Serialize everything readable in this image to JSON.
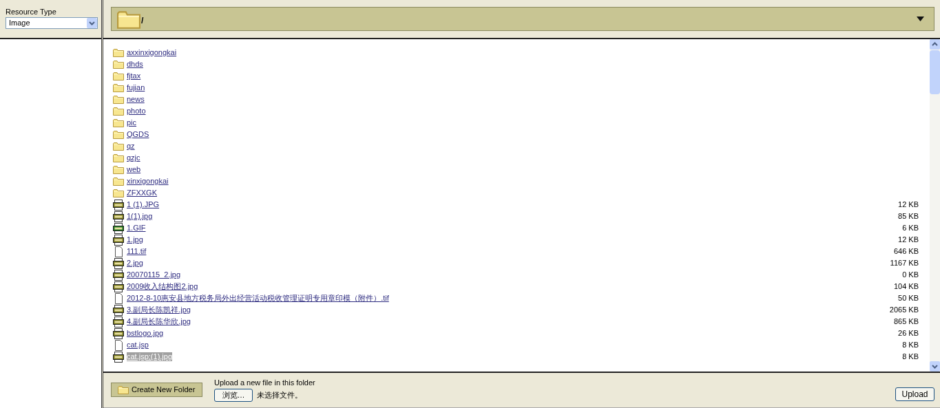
{
  "sidebar": {
    "label": "Resource Type",
    "select": {
      "value": "Image"
    }
  },
  "path_bar": {
    "path": "/"
  },
  "items": [
    {
      "kind": "folder",
      "name": "axxinxigongkai",
      "selected": false
    },
    {
      "kind": "folder",
      "name": "dhds",
      "selected": false
    },
    {
      "kind": "folder",
      "name": "fjtax",
      "selected": false
    },
    {
      "kind": "folder",
      "name": "fujian",
      "selected": false
    },
    {
      "kind": "folder",
      "name": "news",
      "selected": false
    },
    {
      "kind": "folder",
      "name": "photo",
      "selected": false
    },
    {
      "kind": "folder",
      "name": "pic",
      "selected": false
    },
    {
      "kind": "folder",
      "name": "QGDS",
      "selected": false
    },
    {
      "kind": "folder",
      "name": "qz",
      "selected": false
    },
    {
      "kind": "folder",
      "name": "qzjc",
      "selected": false
    },
    {
      "kind": "folder",
      "name": "web",
      "selected": false
    },
    {
      "kind": "folder",
      "name": "xinxigongkai",
      "selected": false
    },
    {
      "kind": "folder",
      "name": "ZFXXGK",
      "selected": false
    },
    {
      "kind": "jpg",
      "name": "1 (1).JPG",
      "size": "12 KB",
      "selected": false
    },
    {
      "kind": "jpg",
      "name": "1(1).jpg",
      "size": "85 KB",
      "selected": false
    },
    {
      "kind": "gif",
      "name": "1.GIF",
      "size": "6 KB",
      "selected": false
    },
    {
      "kind": "jpg",
      "name": "1.jpg",
      "size": "12 KB",
      "selected": false
    },
    {
      "kind": "file",
      "name": "111.tif",
      "size": "646 KB",
      "selected": false
    },
    {
      "kind": "jpg",
      "name": "2.jpg",
      "size": "1167 KB",
      "selected": false
    },
    {
      "kind": "jpg",
      "name": "20070115_2.jpg",
      "size": "0 KB",
      "selected": false
    },
    {
      "kind": "jpg",
      "name": "2009收入结构图2.jpg",
      "size": "104 KB",
      "selected": false
    },
    {
      "kind": "file",
      "name": "2012-8-10惠安县地方税务局外出经营活动税收管理证明专用章印模（附件）.tif",
      "size": "50 KB",
      "selected": false
    },
    {
      "kind": "jpg",
      "name": "3.副局长陈凯祥.jpg",
      "size": "2065 KB",
      "selected": false
    },
    {
      "kind": "jpg",
      "name": "4.副局长陈华欣.jpg",
      "size": "865 KB",
      "selected": false
    },
    {
      "kind": "jpg",
      "name": "bstlogo.jpg",
      "size": "26 KB",
      "selected": false
    },
    {
      "kind": "file",
      "name": "cat.jsp",
      "size": "8 KB",
      "selected": false
    },
    {
      "kind": "jpg",
      "name": "cat.jsp;(1).jpg",
      "size": "8 KB",
      "selected": true
    }
  ],
  "footer": {
    "create_folder": "Create New Folder",
    "upload_label": "Upload a new file in this folder",
    "browse": "浏览…",
    "no_file": "未选择文件。",
    "upload": "Upload"
  }
}
